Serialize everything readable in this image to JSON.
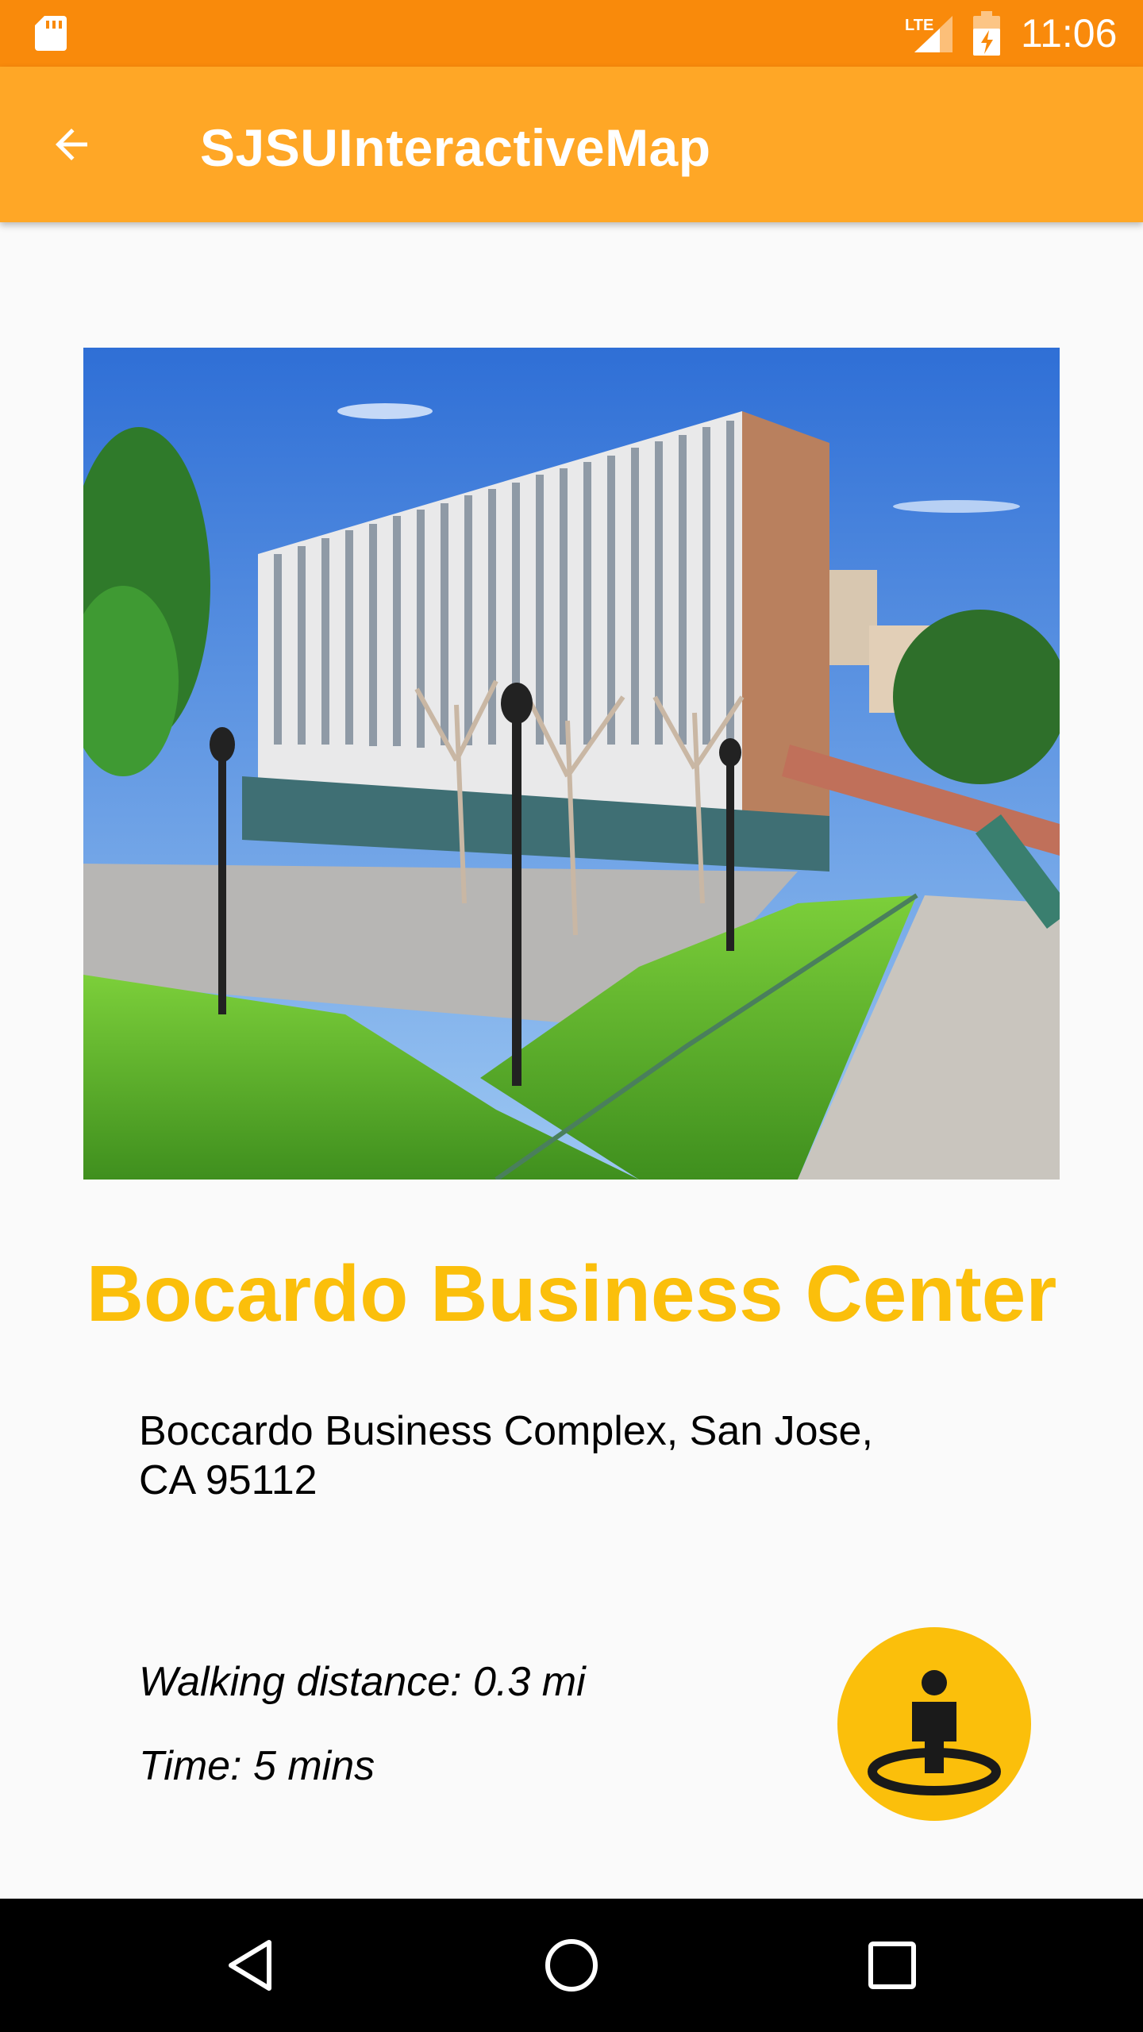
{
  "status_bar": {
    "time": "11:06",
    "network": "LTE",
    "icons": [
      "sd-card-icon",
      "lte-signal-icon",
      "battery-charging-icon"
    ]
  },
  "app_bar": {
    "title": "SJSUInteractiveMap",
    "back_icon": "arrow-back-icon"
  },
  "building": {
    "photo": "building-photo",
    "name": "Bocardo Business Center",
    "address": "Boccardo Business Complex, San Jose, CA 95112",
    "walking_distance": "Walking distance: 0.3 mi",
    "time": "Time: 5 mins"
  },
  "actions": {
    "navigate_icon": "street-view-person-icon"
  },
  "nav_bar": {
    "items": [
      "back-triangle-icon",
      "home-circle-icon",
      "recents-square-icon"
    ]
  },
  "colors": {
    "status_bar": "#f98a0b",
    "app_bar": "#ffa726",
    "accent": "#fbbf0b",
    "background": "#fafafa"
  }
}
